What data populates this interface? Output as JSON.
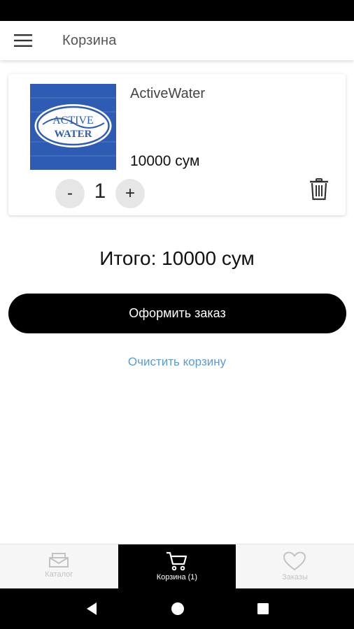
{
  "header": {
    "title": "Корзина",
    "menu_icon": "hamburger-icon"
  },
  "cart": {
    "items": [
      {
        "name": "ActiveWater",
        "price": "10000 сум",
        "quantity": "1",
        "minus_label": "-",
        "plus_label": "+",
        "image": {
          "logo_text_line1": "ACTIVE",
          "logo_text_line2": "WATER",
          "bg_color": "#2e5bb4"
        }
      }
    ],
    "total_label": "Итого:",
    "total_value": "10000 сум",
    "checkout_label": "Оформить заказ",
    "clear_label": "Очистить корзину"
  },
  "bottom_nav": {
    "items": [
      {
        "label": "Каталог",
        "icon": "catalog-icon",
        "active": false
      },
      {
        "label": "Корзина (1)",
        "icon": "cart-icon",
        "active": true
      },
      {
        "label": "Заказы",
        "icon": "heart-icon",
        "active": false
      }
    ]
  },
  "colors": {
    "accent": "#000000",
    "link": "#5b9bd0",
    "logo_bg": "#2e5bb4"
  }
}
